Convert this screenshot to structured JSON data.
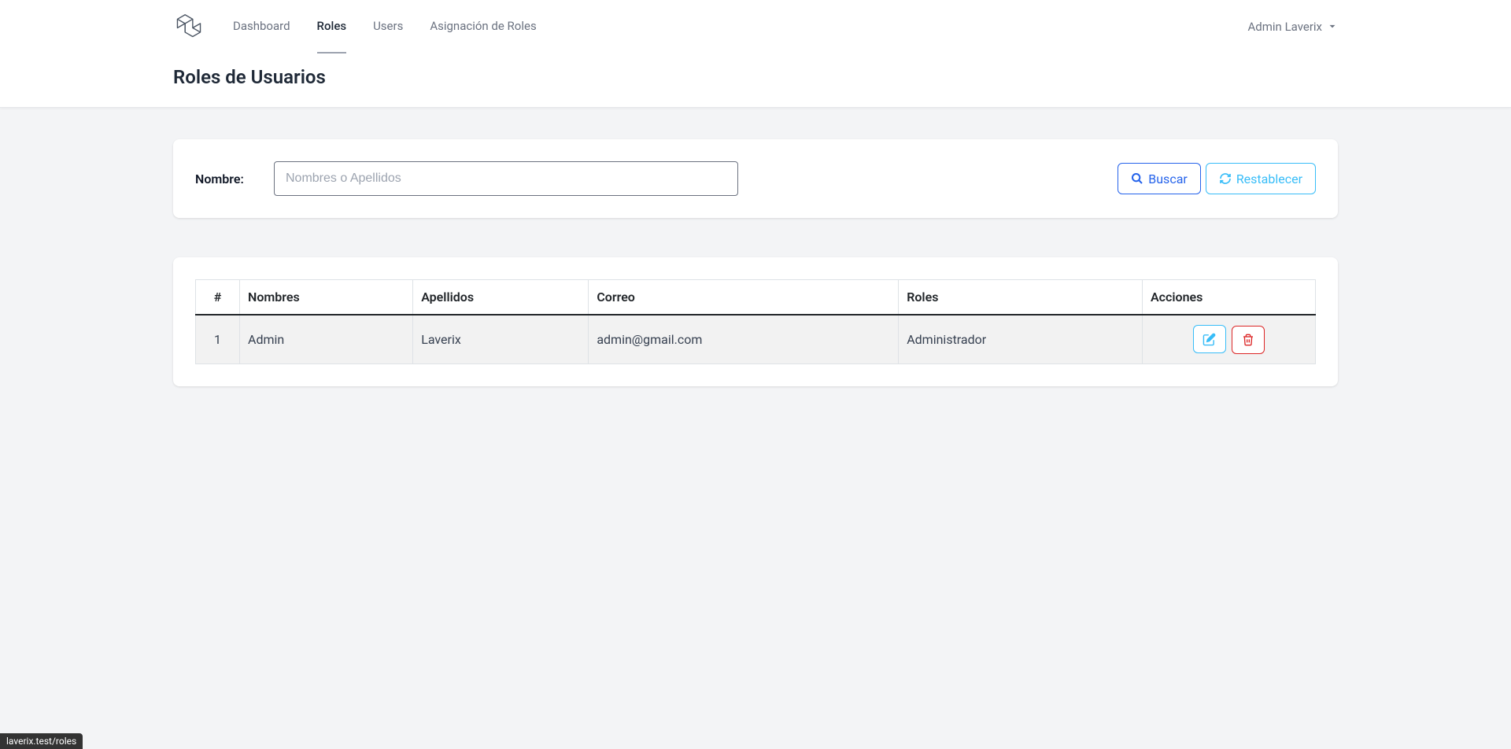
{
  "nav": {
    "items": [
      {
        "label": "Dashboard",
        "active": false
      },
      {
        "label": "Roles",
        "active": true
      },
      {
        "label": "Users",
        "active": false
      },
      {
        "label": "Asignación de Roles",
        "active": false
      }
    ],
    "user": "Admin Laverix"
  },
  "page": {
    "title": "Roles de Usuarios"
  },
  "search": {
    "label": "Nombre:",
    "placeholder": "Nombres o Apellidos",
    "buscar": "Buscar",
    "restablecer": "Restablecer"
  },
  "table": {
    "headers": {
      "num": "#",
      "nombres": "Nombres",
      "apellidos": "Apellidos",
      "correo": "Correo",
      "roles": "Roles",
      "acciones": "Acciones"
    },
    "rows": [
      {
        "num": "1",
        "nombres": "Admin",
        "apellidos": "Laverix",
        "correo": "admin@gmail.com",
        "roles": "Administrador"
      }
    ]
  },
  "statusbar": "laverix.test/roles"
}
